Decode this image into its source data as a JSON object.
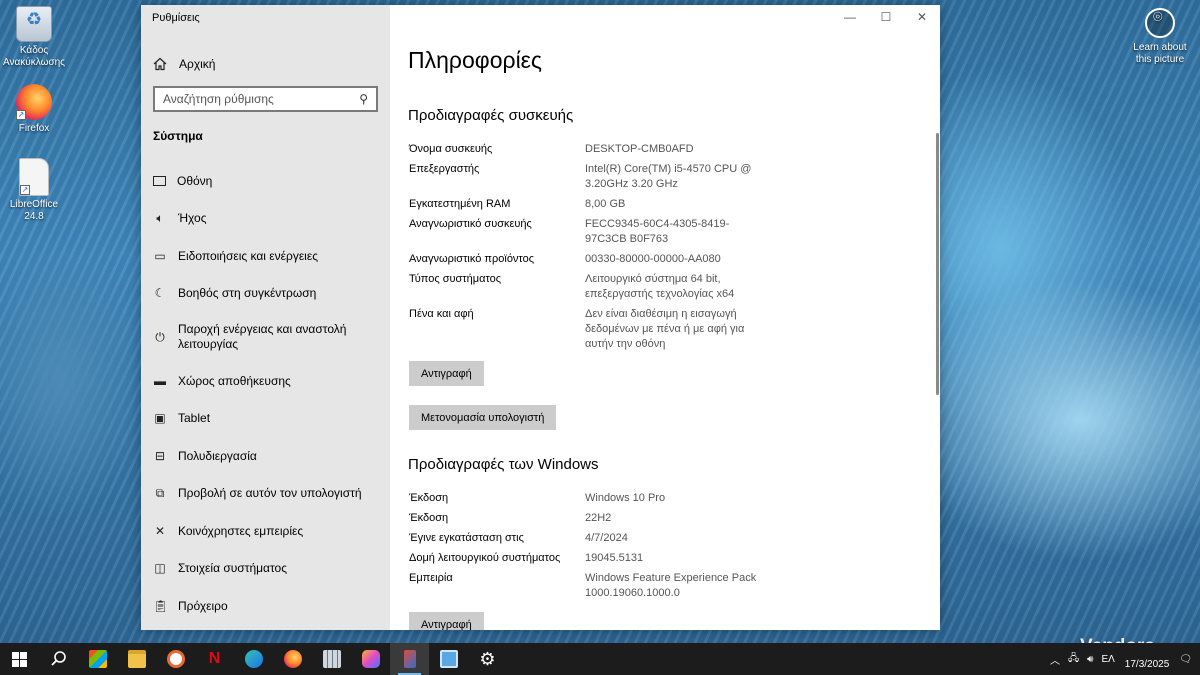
{
  "desktop": {
    "icons": [
      {
        "label": "Κάδος Ανακύκλωσης"
      },
      {
        "label": "Firefox"
      },
      {
        "label": "LibreOffice 24.8"
      }
    ],
    "learn_about": "Learn about this picture",
    "watermark": "Vendora"
  },
  "window": {
    "title": "Ρυθμίσεις",
    "controls": {
      "minimize": "—",
      "maximize": "☐",
      "close": "✕"
    }
  },
  "sidebar": {
    "home_label": "Αρχική",
    "search_placeholder": "Αναζήτηση ρύθμισης",
    "section_title": "Σύστημα",
    "items": [
      {
        "label": "Οθόνη",
        "icon": "monitor-icon"
      },
      {
        "label": "Ήχος",
        "icon": "speaker-icon"
      },
      {
        "label": "Ειδοποιήσεις και ενέργειες",
        "icon": "notification-icon"
      },
      {
        "label": "Βοηθός στη συγκέντρωση",
        "icon": "moon-icon"
      },
      {
        "label": "Παροχή ενέργειας και αναστολή λειτουργίας",
        "icon": "power-icon"
      },
      {
        "label": "Χώρος αποθήκευσης",
        "icon": "storage-icon"
      },
      {
        "label": "Tablet",
        "icon": "tablet-icon"
      },
      {
        "label": "Πολυδιεργασία",
        "icon": "multitasking-icon"
      },
      {
        "label": "Προβολή σε αυτόν τον υπολογιστή",
        "icon": "projecting-icon"
      },
      {
        "label": "Κοινόχρηστες εμπειρίες",
        "icon": "shared-icon"
      },
      {
        "label": "Στοιχεία συστήματος",
        "icon": "system-components-icon"
      },
      {
        "label": "Πρόχειρο",
        "icon": "clipboard-icon"
      }
    ]
  },
  "content": {
    "title": "Πληροφορίες",
    "device_specs": {
      "heading": "Προδιαγραφές συσκευής",
      "rows": [
        {
          "k": "Όνομα συσκευής",
          "v": "DESKTOP-CMB0AFD"
        },
        {
          "k": "Επεξεργαστής",
          "v": "Intel(R) Core(TM) i5-4570 CPU @ 3.20GHz   3.20 GHz"
        },
        {
          "k": "Εγκατεστημένη RAM",
          "v": "8,00 GB"
        },
        {
          "k": "Αναγνωριστικό συσκευής",
          "v": "FECC9345-60C4-4305-8419-97C3CB B0F763"
        },
        {
          "k": "Αναγνωριστικό προϊόντος",
          "v": "00330-80000-00000-AA080"
        },
        {
          "k": "Τύπος συστήματος",
          "v": "Λειτουργικό σύστημα 64 bit, επεξεργαστής τεχνολογίας x64"
        },
        {
          "k": "Πένα και αφή",
          "v": "Δεν είναι διαθέσιμη η εισαγωγή δεδομένων με πένα ή με αφή για αυτήν την οθόνη"
        }
      ],
      "copy_button": "Αντιγραφή",
      "rename_button": "Μετονομασία υπολογιστή"
    },
    "windows_specs": {
      "heading": "Προδιαγραφές των Windows",
      "rows": [
        {
          "k": "Έκδοση",
          "v": "Windows 10 Pro"
        },
        {
          "k": "Έκδοση",
          "v": "22H2"
        },
        {
          "k": "Έγινε εγκατάσταση στις",
          "v": "4/7/2024"
        },
        {
          "k": "Δομή λειτουργικού συστήματος",
          "v": "19045.5131"
        },
        {
          "k": "Εμπειρία",
          "v": "Windows Feature Experience Pack 1000.19060.1000.0"
        }
      ],
      "copy_button": "Αντιγραφή"
    }
  },
  "taskbar": {
    "apps": [
      "start",
      "search",
      "store",
      "file-explorer",
      "media",
      "netflix",
      "edge",
      "firefox",
      "calculator",
      "copilot",
      "active-app",
      "remote-desktop",
      "settings"
    ],
    "tray": {
      "lang": "ΕΛ",
      "date": "17/3/2025"
    }
  }
}
